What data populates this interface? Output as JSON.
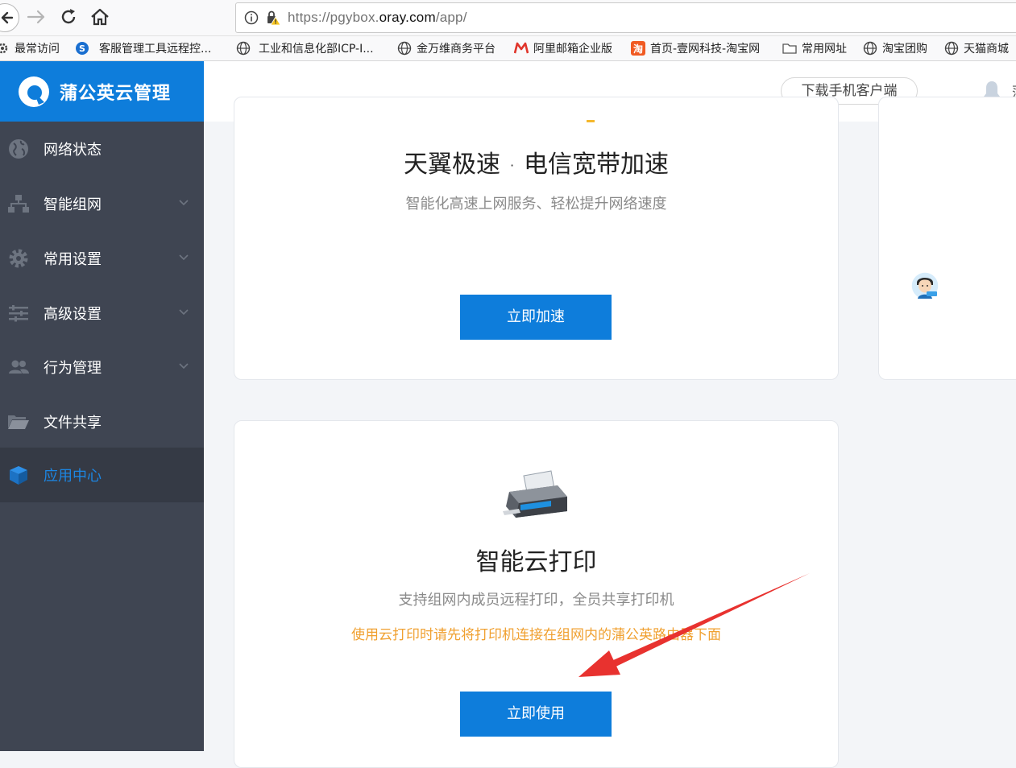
{
  "browser": {
    "url_prefix": "https://pgybox.",
    "url_domain": "oray.com",
    "url_suffix": "/app/",
    "bookmarks": [
      {
        "label": "最常访问",
        "icon": "gear-icon"
      },
      {
        "label": "客服管理工具远程控...",
        "icon": "support-icon"
      },
      {
        "label": "工业和信息化部ICP-I...",
        "icon": "globe-icon"
      },
      {
        "label": "金万维商务平台",
        "icon": "globe-icon"
      },
      {
        "label": "阿里邮箱企业版",
        "icon": "mail-m-icon"
      },
      {
        "label": "首页-壹网科技-淘宝网",
        "icon": "taobao-icon"
      },
      {
        "label": "常用网址",
        "icon": "folder-icon"
      },
      {
        "label": "淘宝团购",
        "icon": "globe-icon"
      },
      {
        "label": "天猫商城",
        "icon": "globe-icon"
      }
    ]
  },
  "header": {
    "brand_name": "蒲公英云管理",
    "download_label": "下载手机客户端",
    "user_initial": "蒲"
  },
  "sidebar": {
    "items": [
      {
        "label": "网络状态",
        "icon": "globe-icon",
        "expandable": false,
        "active": false
      },
      {
        "label": "智能组网",
        "icon": "network-icon",
        "expandable": true,
        "active": false
      },
      {
        "label": "常用设置",
        "icon": "gear-icon",
        "expandable": true,
        "active": false
      },
      {
        "label": "高级设置",
        "icon": "sliders-icon",
        "expandable": true,
        "active": false
      },
      {
        "label": "行为管理",
        "icon": "users-icon",
        "expandable": true,
        "active": false
      },
      {
        "label": "文件共享",
        "icon": "folder-open-icon",
        "expandable": false,
        "active": false
      },
      {
        "label": "应用中心",
        "icon": "cube-icon",
        "expandable": false,
        "active": true
      }
    ]
  },
  "main": {
    "card1": {
      "title_part1": "天翼极速",
      "title_sep": "·",
      "title_part2": "电信宽带加速",
      "description": "智能化高速上网服务、轻松提升网络速度",
      "button_label": "立即加速"
    },
    "card2": {
      "title": "智能云打印",
      "description": "支持组网内成员远程打印，全员共享打印机",
      "note": "使用云打印时请先将打印机连接在组网内的蒲公英路由器下面",
      "button_label": "立即使用"
    }
  },
  "colors": {
    "brand_blue": "#0e7ddb",
    "sidebar_bg": "#3f4552",
    "note_orange": "#f0a030",
    "arrow_red": "#e8322f"
  }
}
